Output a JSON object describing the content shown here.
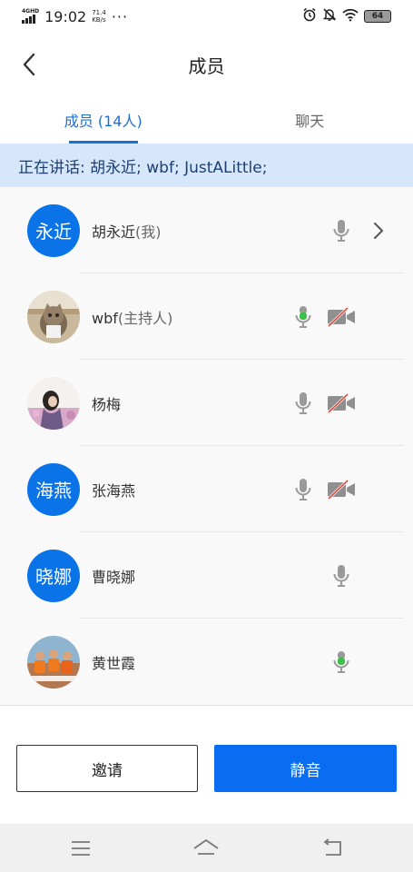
{
  "status_bar": {
    "network_label": "4GHD",
    "time": "19:02",
    "speed_value": "71.4",
    "speed_unit": "KB/s",
    "more": "···",
    "battery": "64"
  },
  "header": {
    "title": "成员"
  },
  "tabs": [
    {
      "label": "成员 (14人)",
      "active": true
    },
    {
      "label": "聊天",
      "active": false
    }
  ],
  "speaking": {
    "text": "正在讲话: 胡永近; wbf; JustALittle;"
  },
  "members": [
    {
      "avatar_text": "永近",
      "name": "胡永近",
      "suffix": "(我)",
      "mic": "gray",
      "video": "none",
      "chevron": true
    },
    {
      "avatar_text": "",
      "avatar_icon": "cat-photo",
      "name": "wbf",
      "suffix": "(主持人)",
      "mic": "green",
      "video": "off",
      "chevron": false
    },
    {
      "avatar_text": "",
      "avatar_icon": "flower-field-photo",
      "name": "杨梅",
      "suffix": "",
      "mic": "gray",
      "video": "off",
      "chevron": false
    },
    {
      "avatar_text": "海燕",
      "name": "张海燕",
      "suffix": "",
      "mic": "gray",
      "video": "off",
      "chevron": false
    },
    {
      "avatar_text": "晓娜",
      "name": "曹晓娜",
      "suffix": "",
      "mic": "gray",
      "video": "none",
      "chevron": false
    },
    {
      "avatar_text": "",
      "avatar_icon": "rafting-group-photo",
      "name": "黄世霞",
      "suffix": "",
      "mic": "green",
      "video": "none",
      "chevron": false
    }
  ],
  "footer": {
    "invite_label": "邀请",
    "mute_label": "静音"
  },
  "colors": {
    "accent": "#0a6cf0",
    "avatar_blue": "#0a73e8",
    "banner_bg": "#d6e7fb",
    "mic_green": "#3cc14a",
    "mic_gray": "#9a9a9a",
    "video_off_red": "#e0453a"
  }
}
